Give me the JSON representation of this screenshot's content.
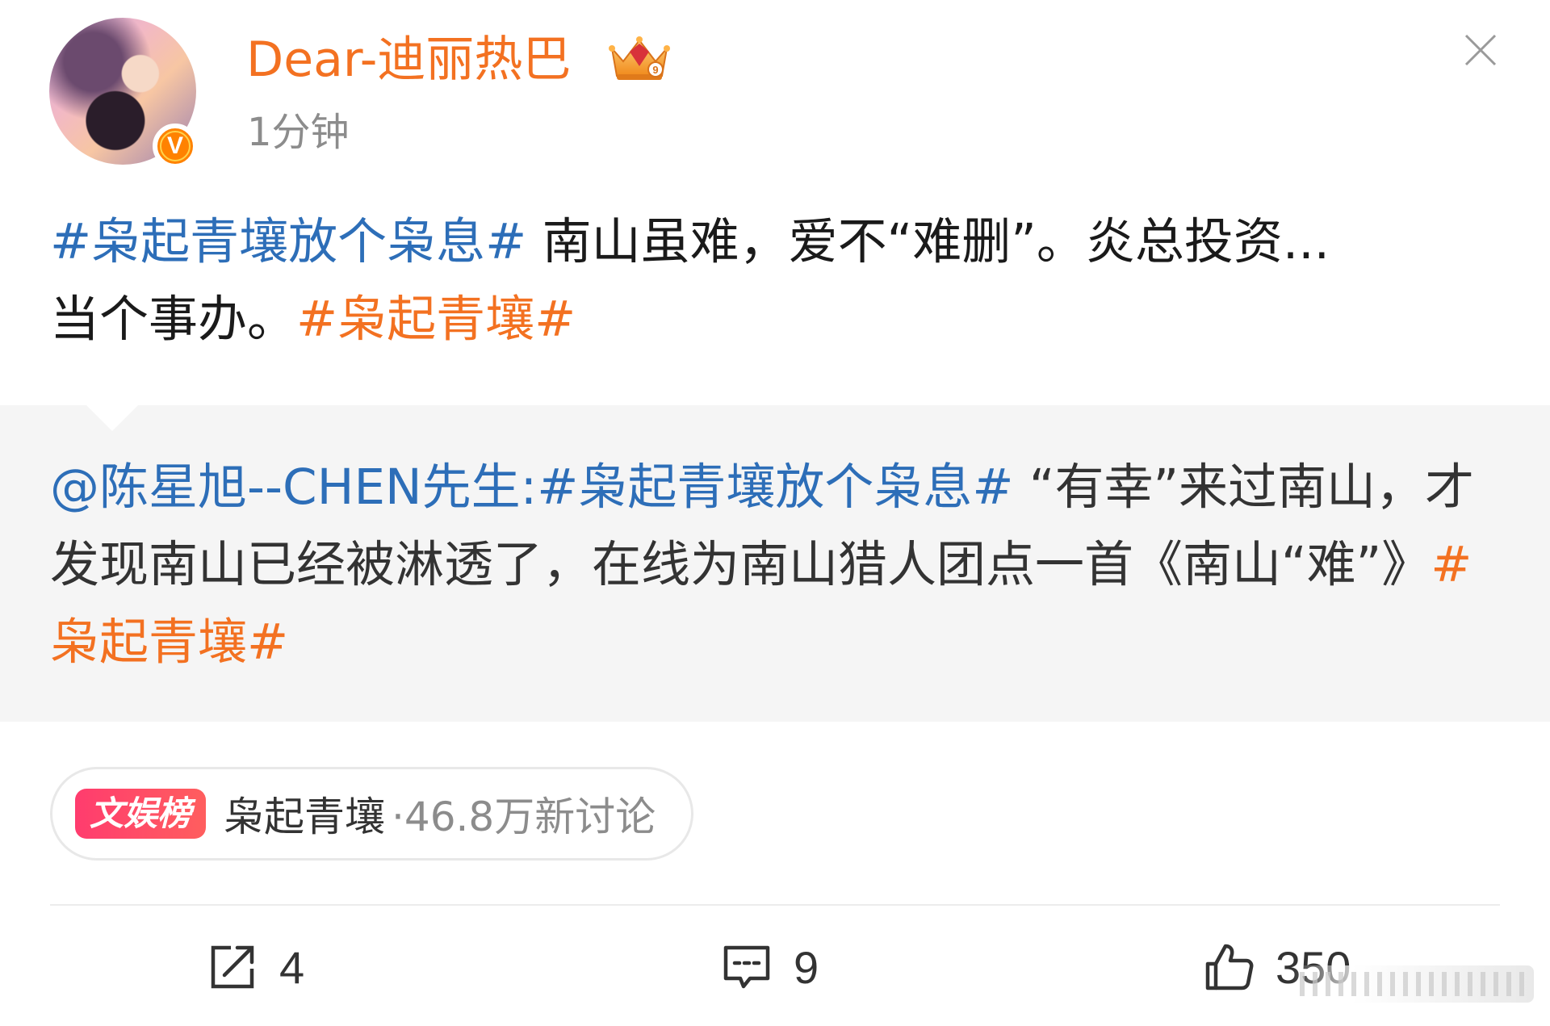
{
  "post": {
    "author": "Dear-迪丽热巴",
    "time": "1分钟",
    "verified_mark": "V",
    "text": {
      "tag1": "#枭起青壤放个枭息#",
      "body1": " 南山虽难，爱不“难删”。炎总投资...",
      "body2": "当个事办。",
      "tag2": "#枭起青壤#"
    }
  },
  "repost": {
    "mention": "@陈星旭--CHEN先生:",
    "tag1": "#枭起青壤放个枭息#",
    "body": " “有幸”来过南山，才发现南山已经被淋透了，在线为南山猎人团点一首《南山“难”》",
    "tag2": "#枭起青壤#"
  },
  "topic": {
    "label": "文娱榜",
    "name": "枭起青壤",
    "count": "·46.8万新讨论"
  },
  "actions": {
    "repost_count": "4",
    "comment_count": "9",
    "like_count": "350"
  },
  "colors": {
    "username": "#f37121",
    "hashtag_blue": "#2d6eb8",
    "hashtag_orange": "#f37121",
    "repost_bg": "#f5f5f5",
    "badge": "#ff8200"
  },
  "icons": {
    "crown": "crown-icon",
    "close": "close-icon",
    "repost": "repost-icon",
    "comment": "comment-icon",
    "like": "like-icon"
  }
}
